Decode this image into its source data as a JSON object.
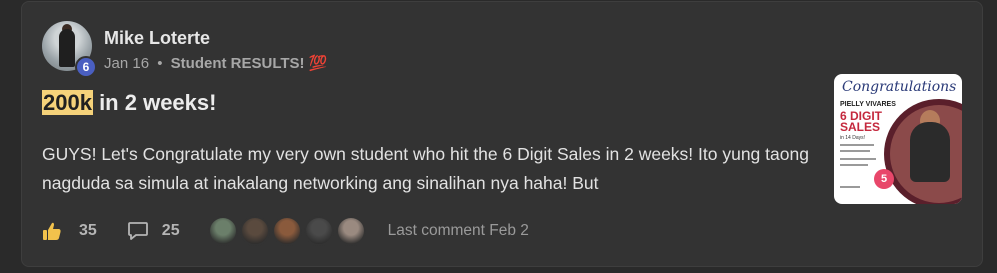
{
  "post": {
    "author": "Mike Loterte",
    "level": "6",
    "date": "Jan 16",
    "separator": "•",
    "category": "Student RESULTS!",
    "category_emoji": "💯",
    "title_highlight": "200k",
    "title_rest": " in 2 weeks!",
    "body": "GUYS! Let's Congratulate my very own student who hit the 6 Digit Sales in 2 weeks! Ito yung taong nagduda sa simula at inakalang networking ang sinalihan nya haha! But",
    "likes": "35",
    "comments": "25",
    "last_comment": "Last comment Feb 2"
  },
  "commenters": [
    {
      "name": "commenter-avatar-1",
      "color": "#6b7f6a"
    },
    {
      "name": "commenter-avatar-2",
      "color": "#5a4a3e"
    },
    {
      "name": "commenter-avatar-3",
      "color": "#8a5a3c"
    },
    {
      "name": "commenter-avatar-4",
      "color": "#4a4a4a"
    },
    {
      "name": "commenter-avatar-5",
      "color": "#9a8a80"
    }
  ],
  "thumbnail": {
    "heading": "Congratulations",
    "name": "PIELLY VIVARES",
    "headline_1": "6 DIGIT",
    "headline_2": "SALES",
    "sub": "in 14 Days!",
    "badge": "5"
  },
  "colors": {
    "background": "#2a2a2a",
    "card": "#333333",
    "highlight": "#f5d27a",
    "level_badge": "#4a5fc1"
  }
}
